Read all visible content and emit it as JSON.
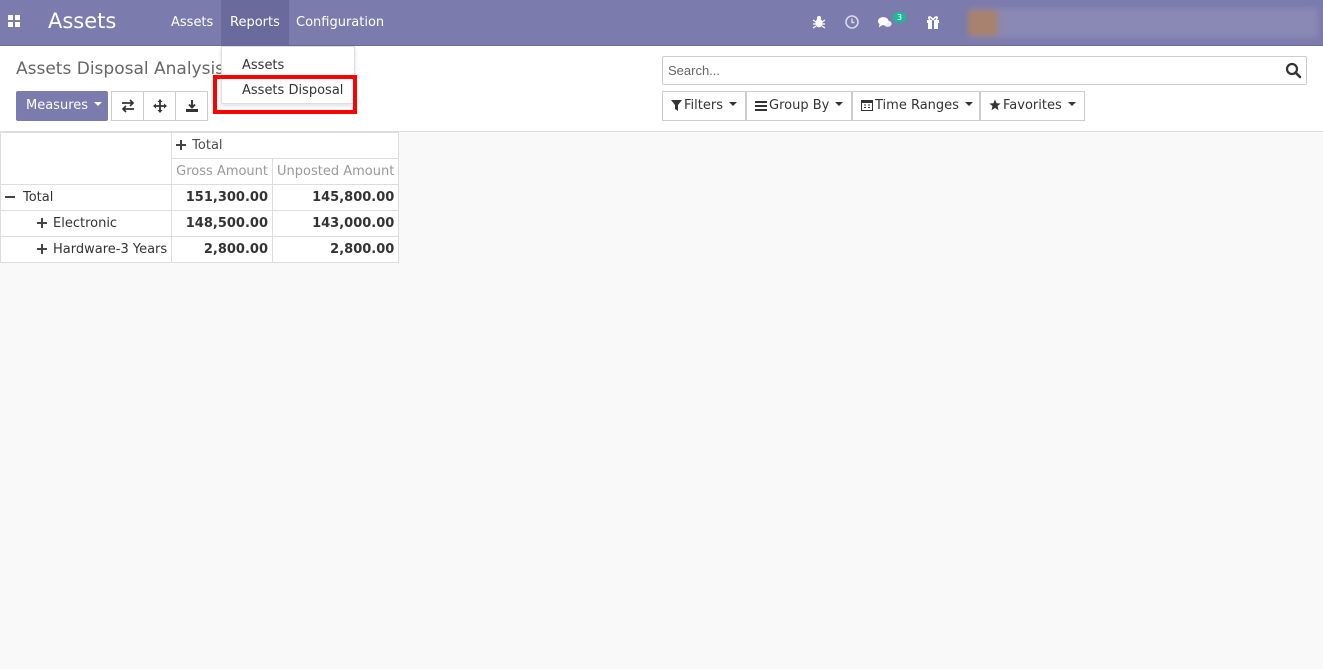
{
  "app": {
    "title": "Assets"
  },
  "menu": {
    "items": [
      "Assets",
      "Reports",
      "Configuration"
    ],
    "active": "Reports"
  },
  "systray": {
    "messages_badge": "3"
  },
  "dropdown": {
    "items": [
      "Assets",
      "Assets Disposal"
    ],
    "highlighted": "Assets Disposal"
  },
  "page": {
    "title": "Assets Disposal Analysis"
  },
  "toolbar": {
    "measures_label": "Measures"
  },
  "search": {
    "placeholder": "Search..."
  },
  "filters": {
    "filters": "Filters",
    "group_by": "Group By",
    "time_ranges": "Time Ranges",
    "favorites": "Favorites"
  },
  "pivot": {
    "column_header": "Total",
    "measures": [
      "Gross Amount",
      "Unposted Amount"
    ],
    "rows": [
      {
        "label": "Total",
        "gross": "151,300.00",
        "unposted": "145,800.00"
      },
      {
        "label": "Electronic",
        "gross": "148,500.00",
        "unposted": "143,000.00"
      },
      {
        "label": "Hardware-3 Years",
        "gross": "2,800.00",
        "unposted": "2,800.00"
      }
    ]
  },
  "colors": {
    "navbar": "#7c7bad",
    "badge": "#21b799",
    "highlight": "#ff0000"
  }
}
